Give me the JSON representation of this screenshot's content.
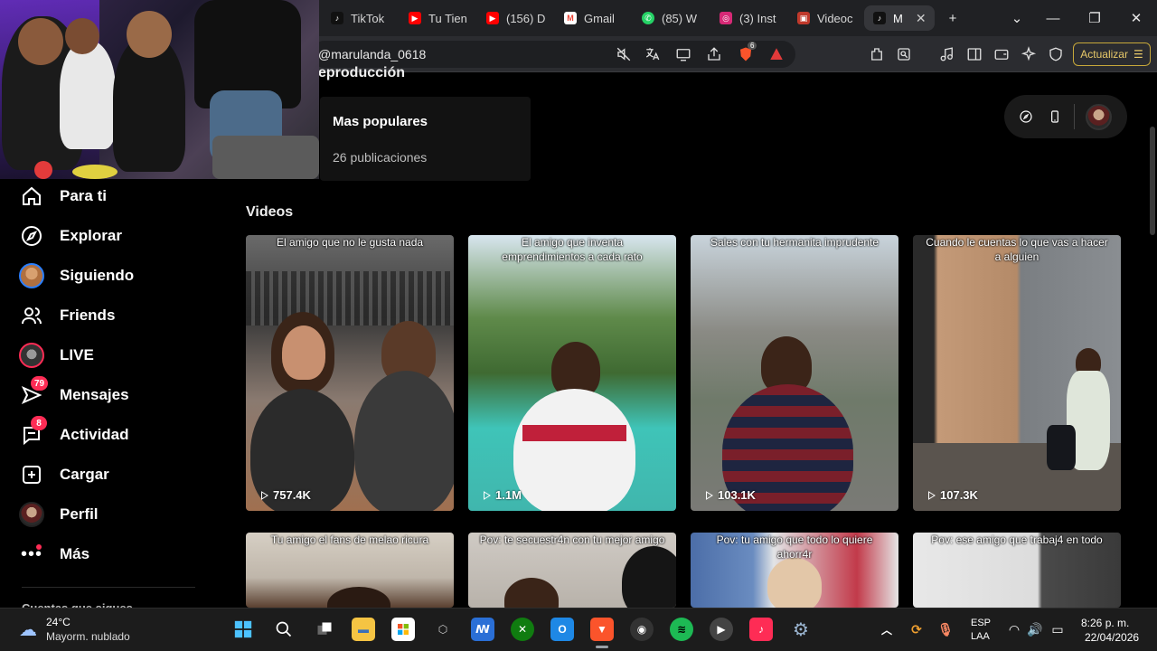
{
  "browser": {
    "tabs": [
      {
        "label": "TikTok",
        "icon": "tiktok-icon",
        "color": "#111111"
      },
      {
        "label": "Tu Tien",
        "icon": "youtube-icon",
        "color": "#ff0000"
      },
      {
        "label": "(156) D",
        "icon": "youtube-icon",
        "color": "#ff0000"
      },
      {
        "label": "Gmail",
        "icon": "gmail-icon",
        "color": "#ea4335"
      },
      {
        "label": "(85) W",
        "icon": "whatsapp-icon",
        "color": "#25d366"
      },
      {
        "label": "(3) Inst",
        "icon": "instagram-icon",
        "color": "#d62976"
      },
      {
        "label": "Videoc",
        "icon": "video-icon",
        "color": "#c0392b"
      },
      {
        "label": "M",
        "icon": "tiktok-icon",
        "color": "#111111"
      }
    ],
    "url": "@marulanda_0618",
    "update_label": "Actualizar",
    "shield_count": "6"
  },
  "profile": {
    "section_title": "eproducción",
    "playlist": {
      "name": "Mas populares",
      "count": "26 publicaciones"
    }
  },
  "sidebar": {
    "items": [
      {
        "label": "Para ti",
        "icon": "home-icon"
      },
      {
        "label": "Explorar",
        "icon": "compass-icon"
      },
      {
        "label": "Siguiendo",
        "icon": "avatar-icon"
      },
      {
        "label": "Friends",
        "icon": "friends-icon"
      },
      {
        "label": "LIVE",
        "icon": "live-avatar-icon"
      },
      {
        "label": "Mensajes",
        "icon": "message-icon",
        "badge": "79"
      },
      {
        "label": "Actividad",
        "icon": "activity-icon",
        "badge": "8"
      },
      {
        "label": "Cargar",
        "icon": "upload-icon"
      },
      {
        "label": "Perfil",
        "icon": "profile-avatar-icon"
      },
      {
        "label": "Más",
        "icon": "more-icon"
      }
    ],
    "following_title": "Cuentas que sigues"
  },
  "videos": {
    "heading": "Videos",
    "items": [
      {
        "caption": "El amigo que no le gusta nada",
        "views": "757.4K"
      },
      {
        "caption": "El amigo que inventa emprendimientos a cada rato",
        "views": "1.1M"
      },
      {
        "caption": "Sales con tu hermanita imprudente",
        "views": "103.1K"
      },
      {
        "caption": "Cuando le cuentas lo que vas a hacer a alguien",
        "views": "107.3K"
      },
      {
        "caption": "Tu amigo el fans de melao ricura",
        "views": ""
      },
      {
        "caption": "Pov: te secuestr4n con tu mejor amigo",
        "views": ""
      },
      {
        "caption": "Pov: tu amigo que todo lo quiere ahorr4r",
        "views": ""
      },
      {
        "caption": "Pov: ese amigo que trabaj4 en todo",
        "views": ""
      }
    ]
  },
  "taskbar": {
    "temp": "24°C",
    "weather": "Mayorm. nublado",
    "lang_top": "ESP",
    "lang_bottom": "LAA",
    "time": "8:26 p. m.",
    "date": "22/04/2026"
  },
  "colors": {
    "accent": "#fe2c55",
    "background": "#000000",
    "update": "#e8c969"
  }
}
